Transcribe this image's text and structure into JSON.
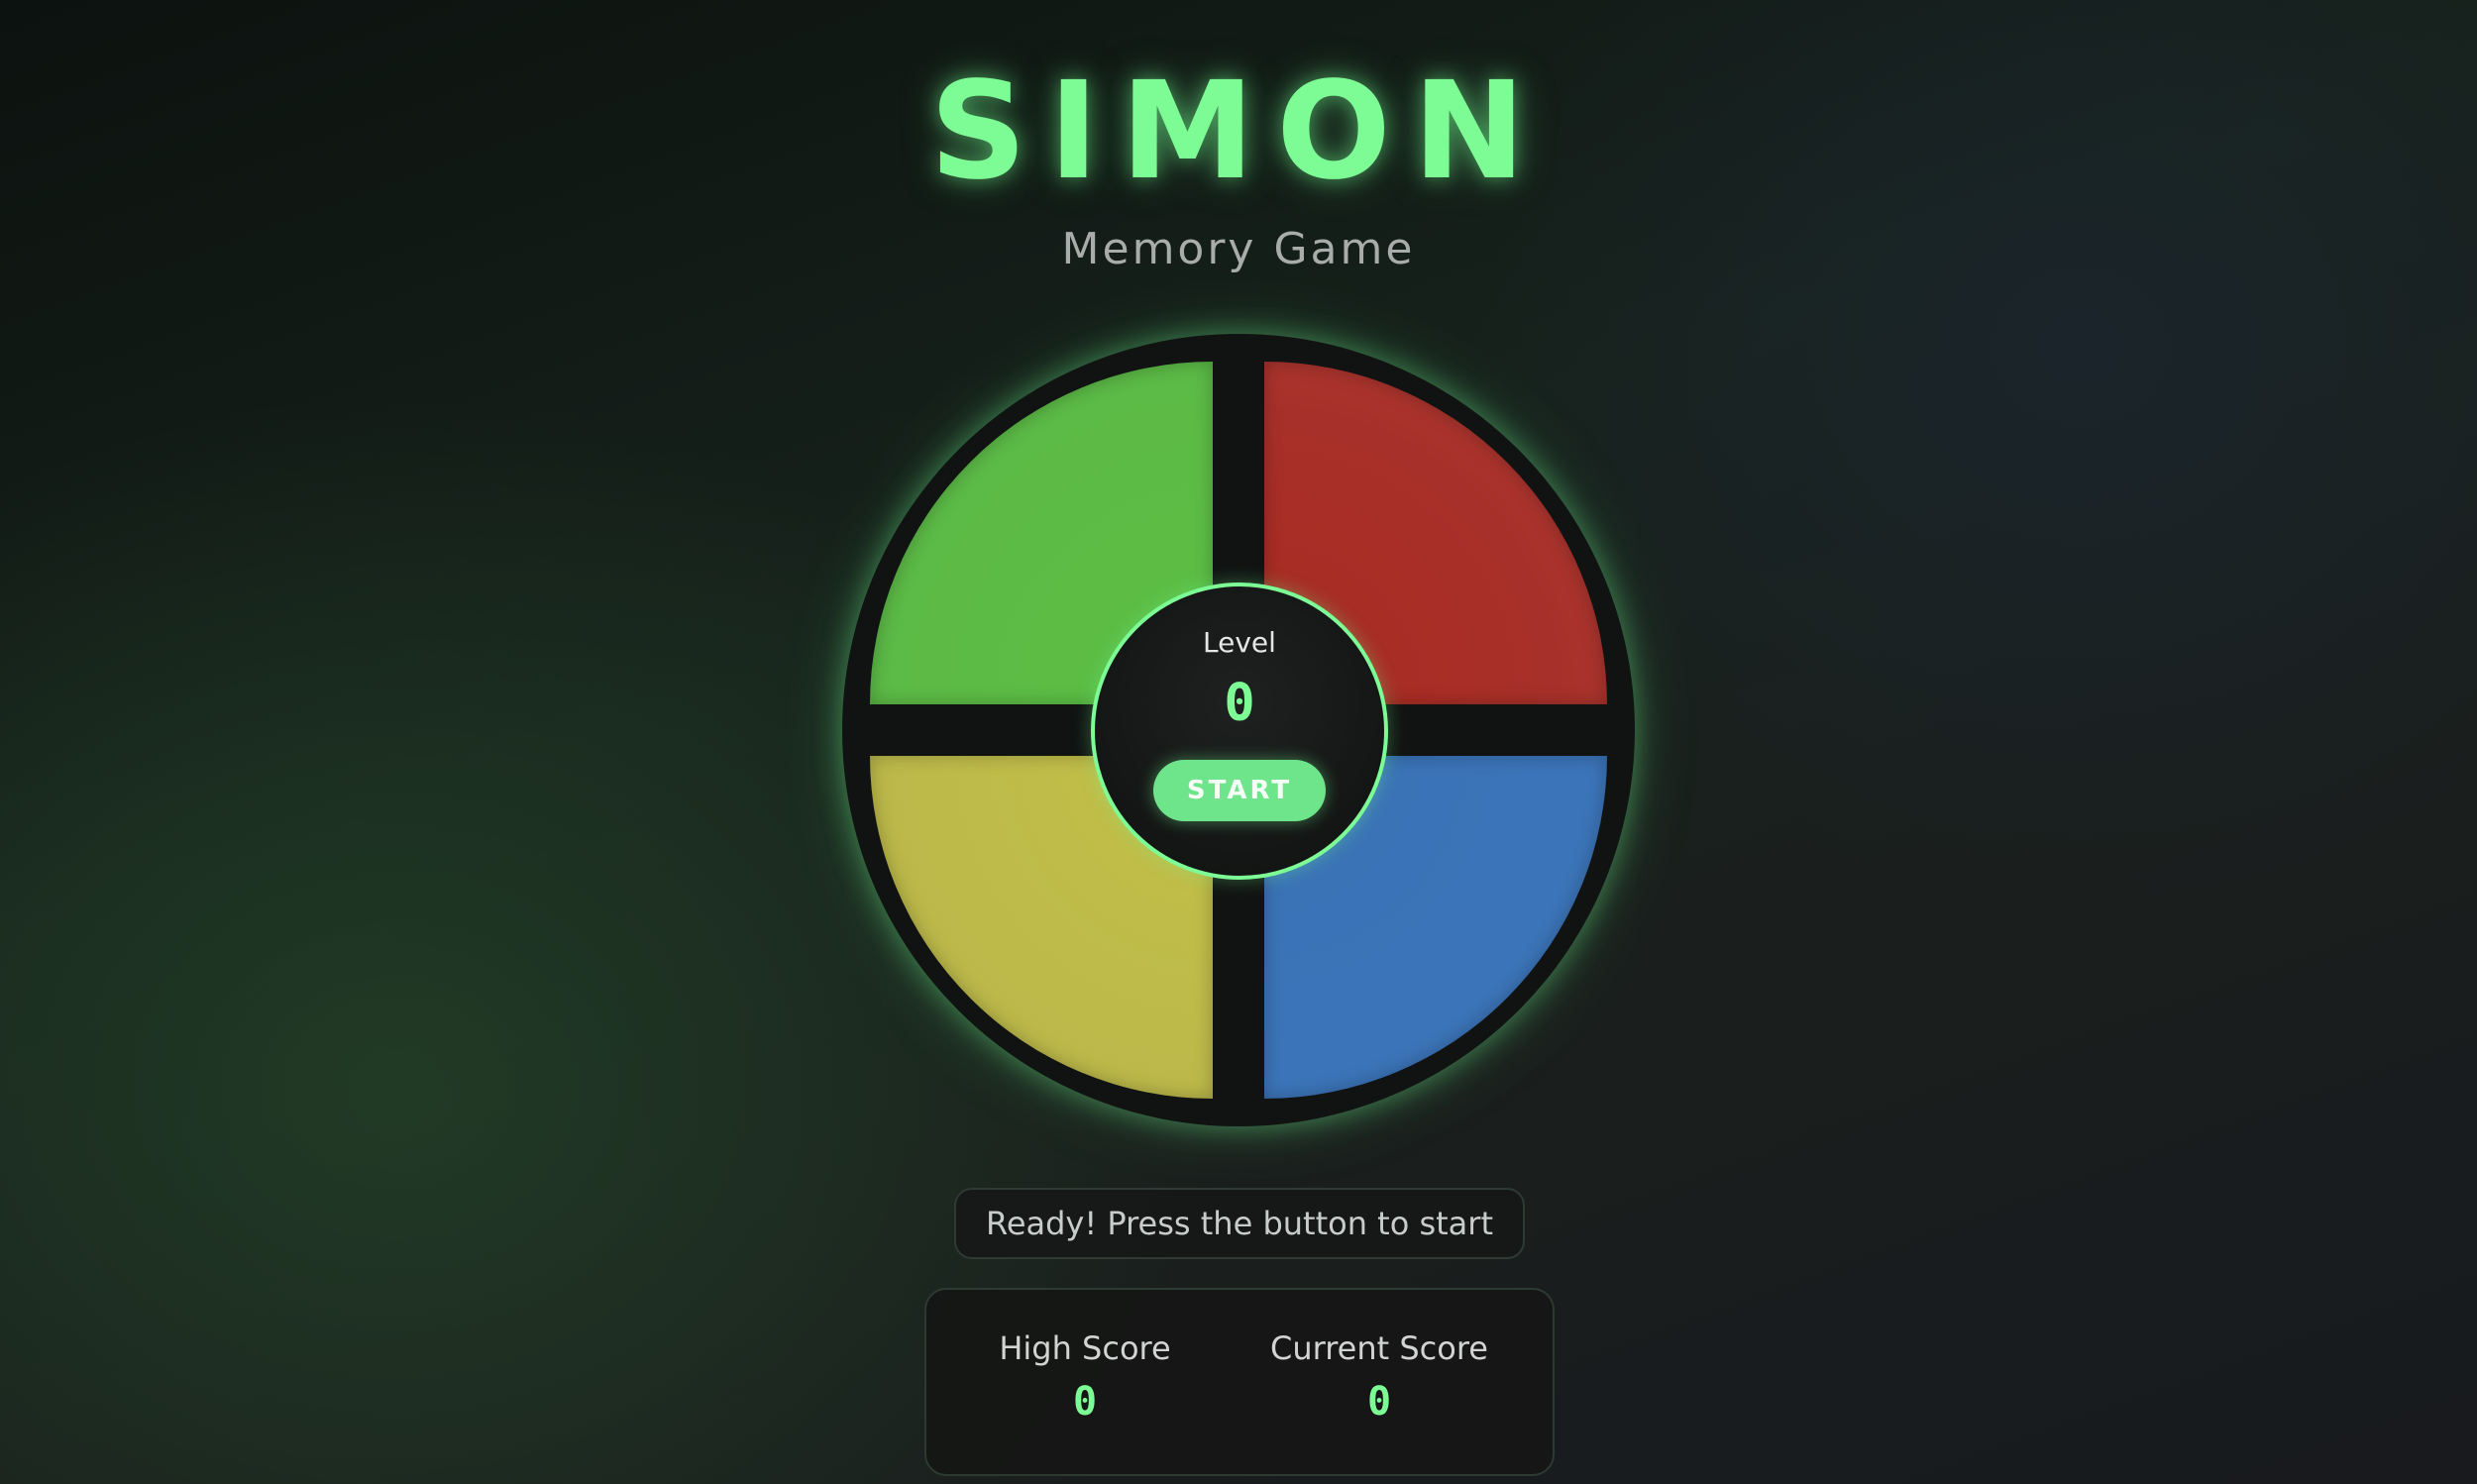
{
  "header": {
    "title": "SIMON",
    "subtitle": "Memory Game"
  },
  "board": {
    "pads": [
      {
        "id": "green",
        "color": "#5cba45"
      },
      {
        "id": "red",
        "color": "#a8302a"
      },
      {
        "id": "yellow",
        "color": "#bdba4a"
      },
      {
        "id": "blue",
        "color": "#3b74b8"
      }
    ],
    "center": {
      "level_label": "Level",
      "level_value": "0",
      "start_label": "START"
    }
  },
  "status": {
    "message": "Ready! Press the button to start"
  },
  "scores": {
    "high_score_label": "High Score",
    "high_score_value": "0",
    "current_score_label": "Current Score",
    "current_score_value": "0"
  },
  "theme": {
    "accent": "#7dfb95",
    "background": "#151c18"
  }
}
